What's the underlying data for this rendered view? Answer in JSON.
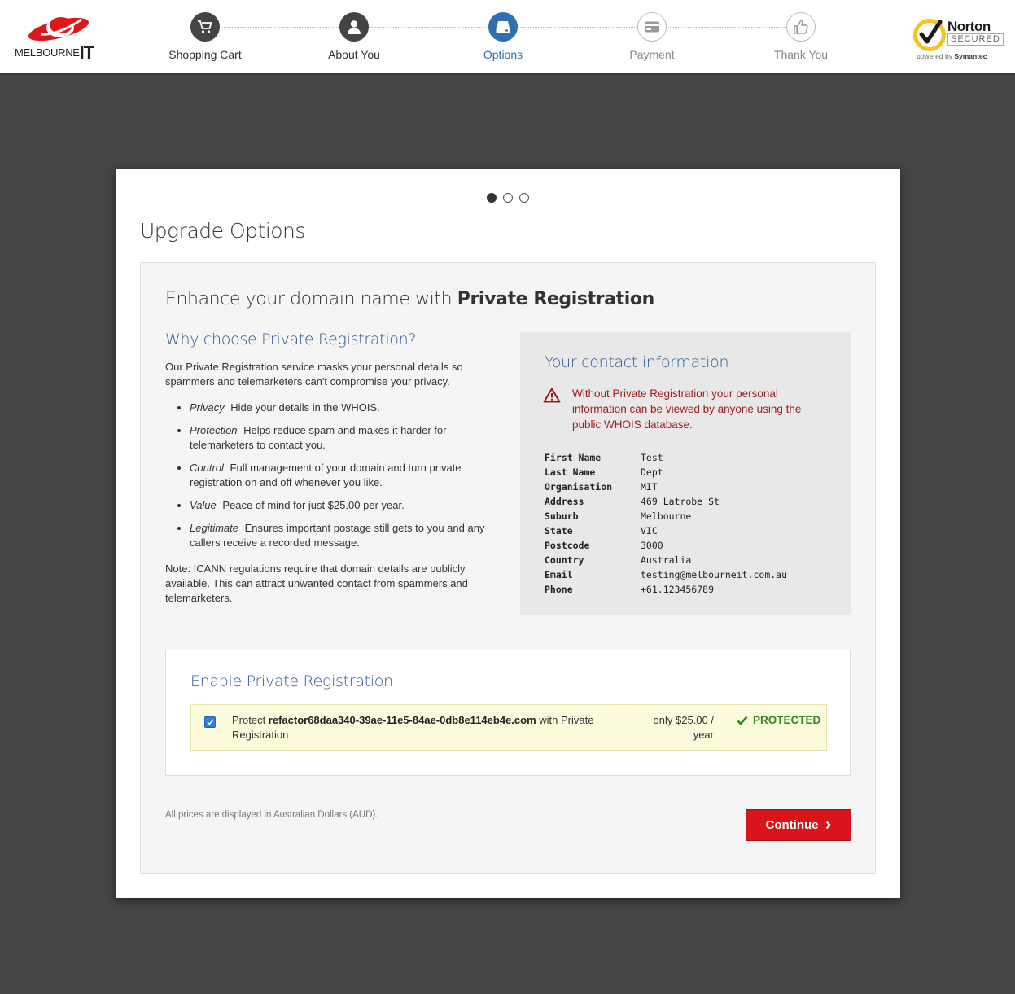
{
  "brand": {
    "logo_text": "MELBOURNE",
    "logo_text_bold": "IT"
  },
  "steps": [
    {
      "label": "Shopping Cart",
      "icon": "cart-icon",
      "state": "done"
    },
    {
      "label": "About You",
      "icon": "user-icon",
      "state": "done"
    },
    {
      "label": "Options",
      "icon": "options-icon",
      "state": "active"
    },
    {
      "label": "Payment",
      "icon": "payment-icon",
      "state": "pending"
    },
    {
      "label": "Thank You",
      "icon": "thumbs-up-icon",
      "state": "pending"
    }
  ],
  "norton": {
    "title": "Norton",
    "secured": "SECURED",
    "powered": "powered by",
    "symantec": "Symantec"
  },
  "carousel": {
    "total": 3,
    "current": 1
  },
  "page": {
    "title": "Upgrade Options"
  },
  "panel": {
    "heading_prefix": "Enhance your domain name with ",
    "heading_bold": "Private Registration"
  },
  "why": {
    "title": "Why choose Private Registration?",
    "intro": "Our Private Registration service masks your personal details so spammers and telemarketers can't compromise your privacy.",
    "bullets": [
      {
        "term": "Privacy",
        "text": "Hide your details in the WHOIS."
      },
      {
        "term": "Protection",
        "text": "Helps reduce spam and makes it harder for telemarketers to contact you."
      },
      {
        "term": "Control",
        "text": "Full management of your domain and turn private registration on and off whenever you like."
      },
      {
        "term": "Value",
        "text": "Peace of mind for just $25.00 per year."
      },
      {
        "term": "Legitimate",
        "text": "Ensures important postage still gets to you and any callers receive a recorded message."
      }
    ],
    "note": "Note: ICANN regulations require that domain details are publicly available. This can attract unwanted contact from spammers and telemarketers."
  },
  "contact": {
    "title": "Your contact information",
    "warning": "Without Private Registration your personal information can be viewed by anyone using the public WHOIS database.",
    "fields": [
      {
        "key": "First Name",
        "value": "Test"
      },
      {
        "key": "Last Name",
        "value": "Dept"
      },
      {
        "key": "Organisation",
        "value": "MIT"
      },
      {
        "key": "Address",
        "value": "469 Latrobe St"
      },
      {
        "key": "Suburb",
        "value": "Melbourne"
      },
      {
        "key": "State",
        "value": "VIC"
      },
      {
        "key": "Postcode",
        "value": "3000"
      },
      {
        "key": "Country",
        "value": "Australia"
      },
      {
        "key": "Email",
        "value": "testing@melbourneit.com.au"
      },
      {
        "key": "Phone",
        "value": "+61.123456789"
      }
    ]
  },
  "enable": {
    "title": "Enable Private Registration",
    "checked": true,
    "protect_prefix": "Protect ",
    "domain": "refactor68daa340-39ae-11e5-84ae-0db8e114eb4e.com",
    "protect_suffix": " with Private Registration",
    "price": "only $25.00 / year",
    "status": "PROTECTED"
  },
  "footer": {
    "currency_note": "All prices are displayed in Australian Dollars (AUD).",
    "continue_label": "Continue"
  },
  "colors": {
    "background": "#454545",
    "accent": "#2f6fae",
    "heading_blue": "#2f5b91",
    "warning_red": "#a01b1b",
    "button_red": "#d9141a",
    "protected_green": "#2e8b1f",
    "highlight_yellow": "#fcfbdc"
  }
}
